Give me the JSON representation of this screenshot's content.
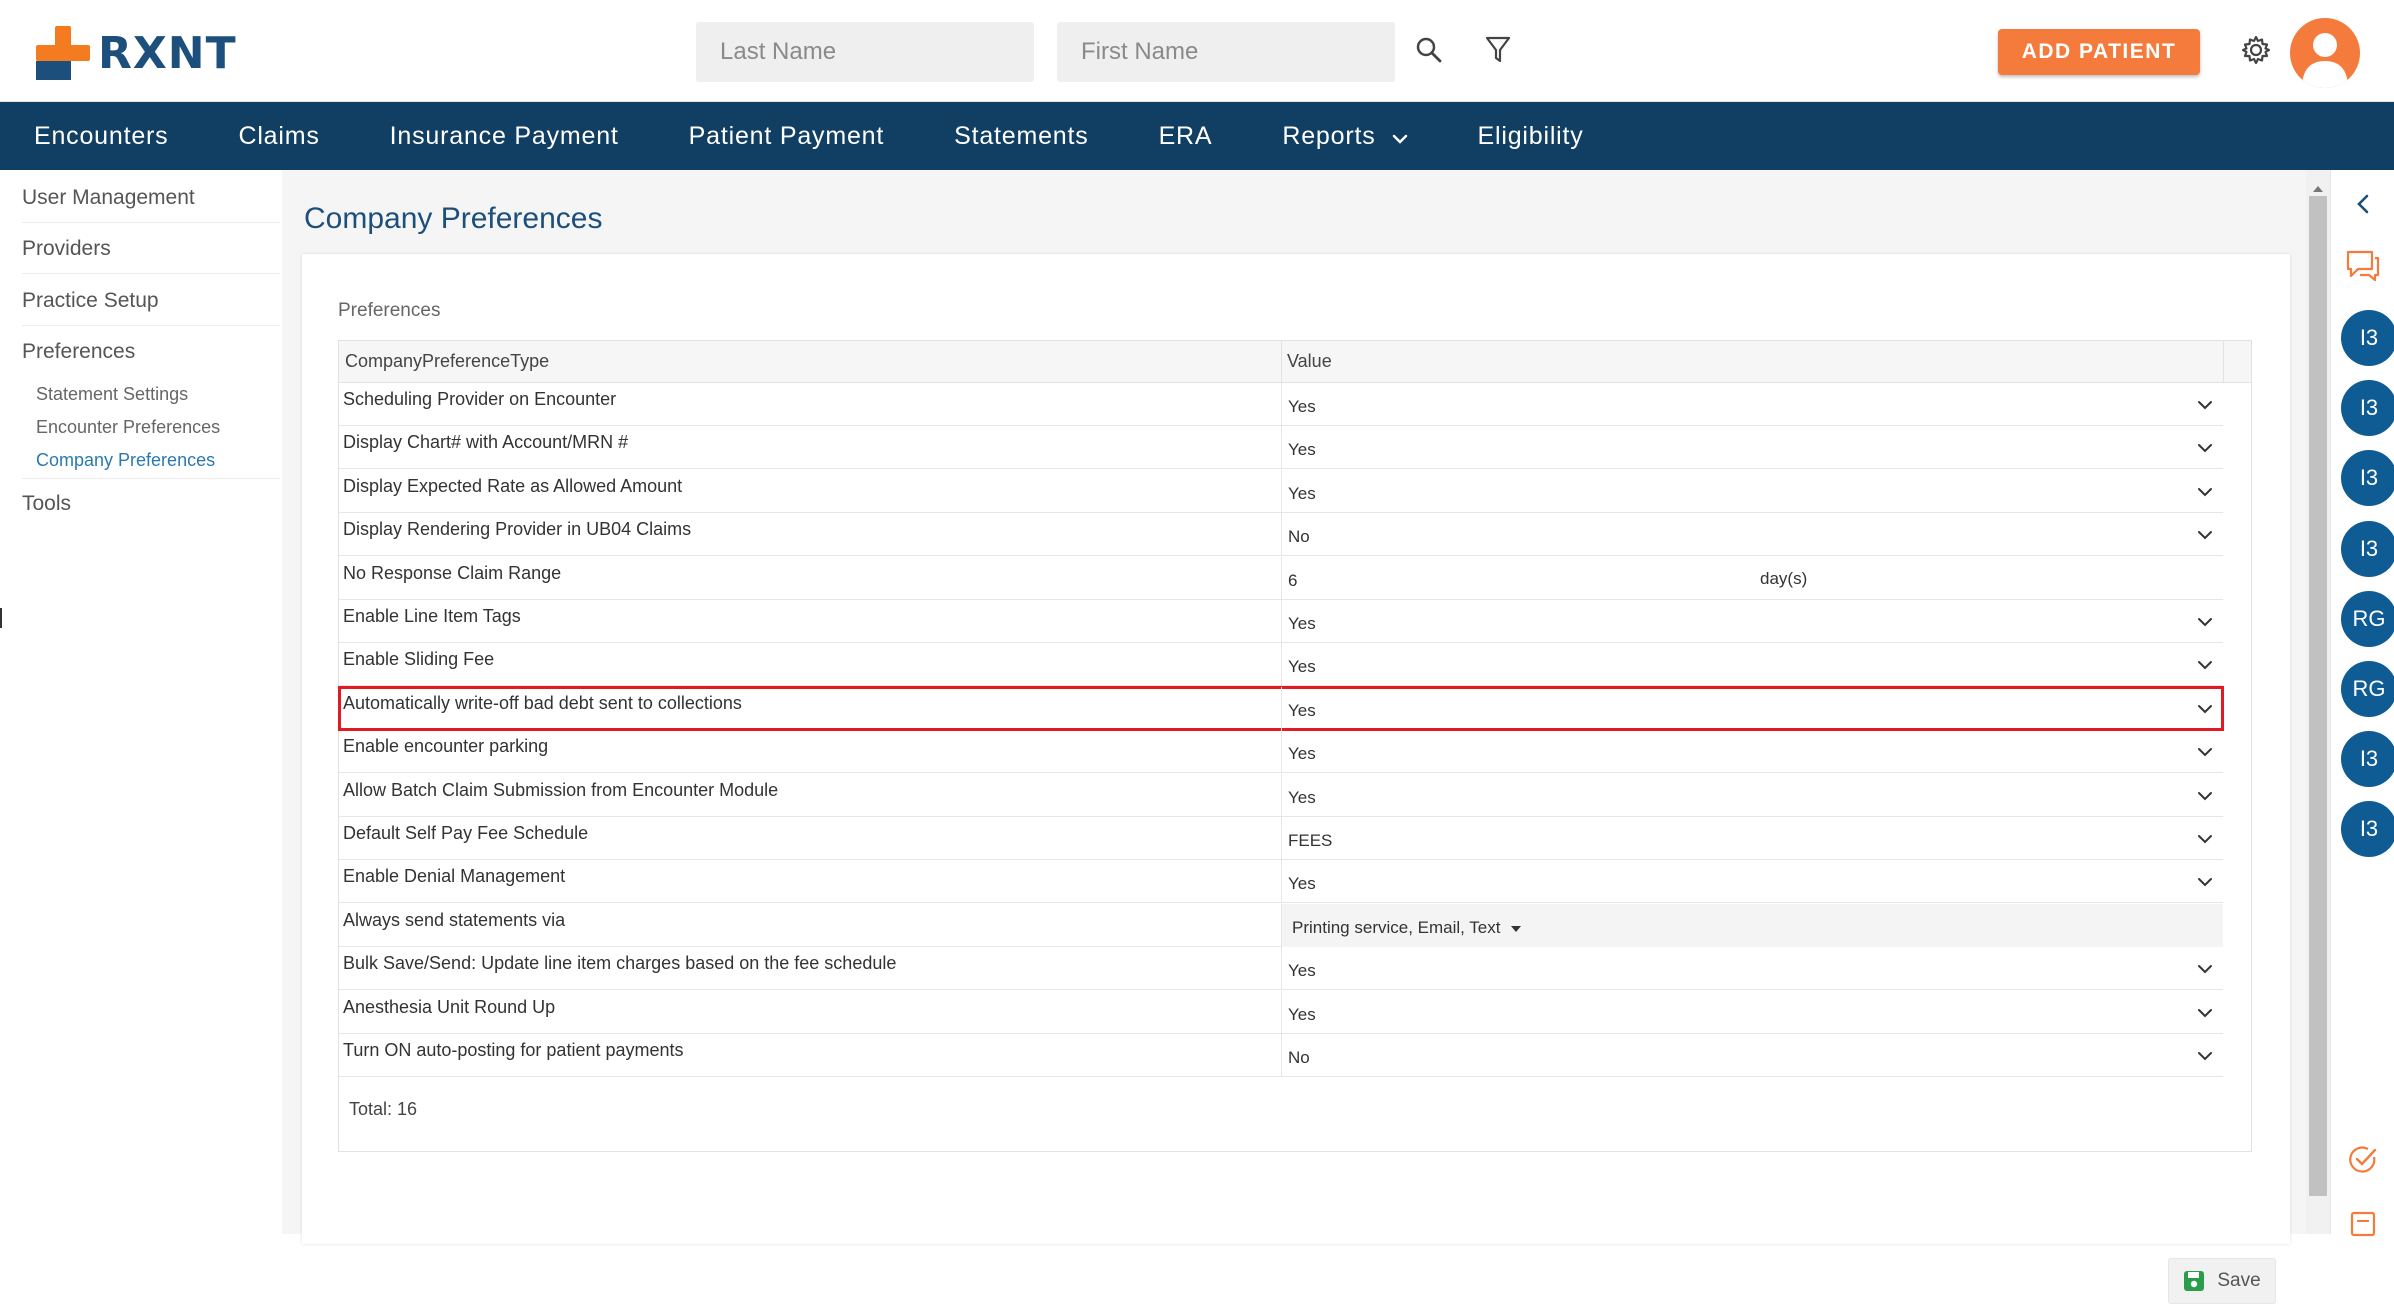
{
  "header": {
    "logo_text": "RXNT",
    "last_name_placeholder": "Last Name",
    "first_name_placeholder": "First Name",
    "add_patient_label": "ADD PATIENT",
    "brand_orange": "#f47b3c",
    "brand_navy": "#113f63"
  },
  "nav": {
    "items": [
      "Encounters",
      "Claims",
      "Insurance Payment",
      "Patient Payment",
      "Statements",
      "ERA",
      "Reports",
      "Eligibility"
    ]
  },
  "sidebar": {
    "items": [
      "User Management",
      "Providers",
      "Practice Setup",
      "Preferences",
      "Tools"
    ],
    "sub_items": [
      "Statement Settings",
      "Encounter Preferences",
      "Company Preferences"
    ]
  },
  "main": {
    "page_title": "Company Preferences",
    "section_label": "Preferences",
    "columns": [
      "CompanyPreferenceType",
      "Value"
    ],
    "rows": [
      {
        "type": "Scheduling Provider on Encounter",
        "value": "Yes"
      },
      {
        "type": "Display Chart# with Account/MRN #",
        "value": "Yes"
      },
      {
        "type": "Display Expected Rate as Allowed Amount",
        "value": "Yes"
      },
      {
        "type": "Display Rendering Provider in UB04 Claims",
        "value": "No"
      },
      {
        "type": "No Response Claim Range",
        "value": "6",
        "unit": "day(s)"
      },
      {
        "type": "Enable Line Item Tags",
        "value": "Yes"
      },
      {
        "type": "Enable Sliding Fee",
        "value": "Yes"
      },
      {
        "type": "Automatically write-off bad debt sent to collections",
        "value": "Yes"
      },
      {
        "type": "Enable encounter parking",
        "value": "Yes"
      },
      {
        "type": "Allow Batch Claim Submission from Encounter Module",
        "value": "Yes"
      },
      {
        "type": "Default Self Pay Fee Schedule",
        "value": "FEES"
      },
      {
        "type": "Enable Denial Management",
        "value": "Yes"
      },
      {
        "type": "Always send statements via",
        "value": "Printing service,  Email,  Text"
      },
      {
        "type": "Bulk Save/Send: Update line item charges based on the fee schedule",
        "value": "Yes"
      },
      {
        "type": "Anesthesia Unit Round Up",
        "value": "Yes"
      },
      {
        "type": "Turn ON auto-posting for patient payments",
        "value": "No"
      }
    ],
    "total": "Total: 16",
    "save_label": "Save"
  },
  "rail": {
    "badges": [
      "I3",
      "I3",
      "I3",
      "I3",
      "RG",
      "RG",
      "I3",
      "I3"
    ]
  }
}
